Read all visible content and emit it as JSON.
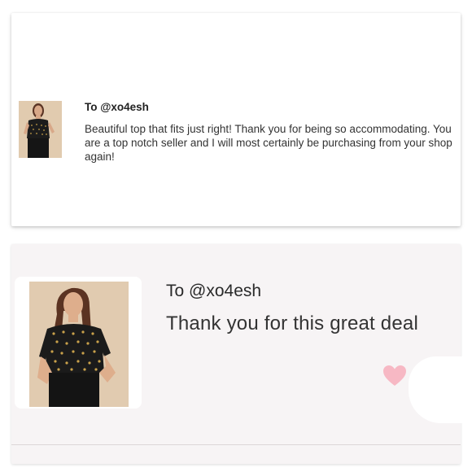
{
  "review_card": {
    "recipient": "To @xo4esh",
    "message": "Beautiful top that fits just right! Thank you for being so accommodating. You are a top notch seller and I will most certainly be purchasing from your shop again!"
  },
  "thanks_card": {
    "recipient": "To @xo4esh",
    "message": "Thank you for this great deal",
    "like_icon": "heart-icon",
    "heart_color": "#f7b8c4"
  }
}
